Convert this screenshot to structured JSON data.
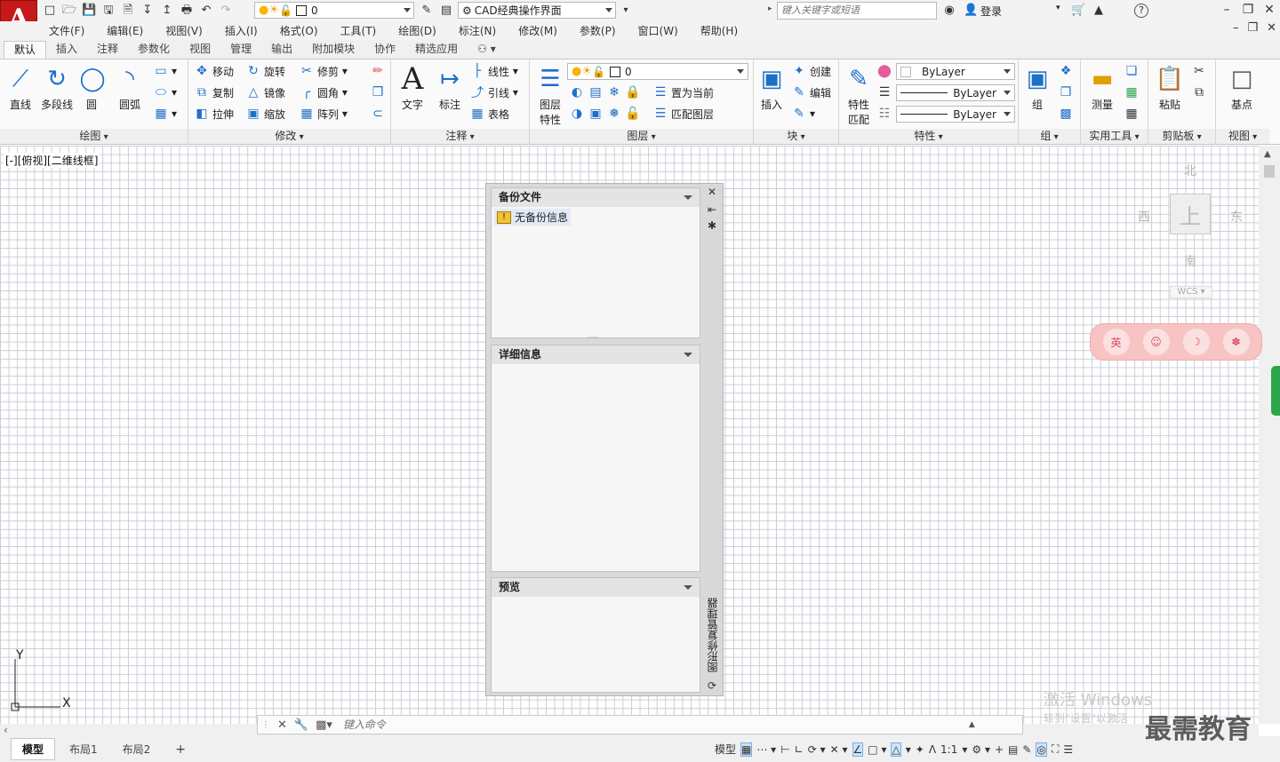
{
  "titlebar": {
    "layer_value": "0",
    "workspace": "CAD经典操作界面",
    "search_placeholder": "键入关键字或短语",
    "login": "登录"
  },
  "menu": [
    "文件(F)",
    "编辑(E)",
    "视图(V)",
    "插入(I)",
    "格式(O)",
    "工具(T)",
    "绘图(D)",
    "标注(N)",
    "修改(M)",
    "参数(P)",
    "窗口(W)",
    "帮助(H)"
  ],
  "ribbon_tabs": [
    "默认",
    "插入",
    "注释",
    "参数化",
    "视图",
    "管理",
    "输出",
    "附加模块",
    "协作",
    "精选应用"
  ],
  "ribbon": {
    "draw": {
      "title": "绘图",
      "line": "直线",
      "polyline": "多段线",
      "circle": "圆",
      "arc": "圆弧"
    },
    "modify": {
      "title": "修改",
      "move": "移动",
      "rotate": "旋转",
      "trim": "修剪",
      "copy": "复制",
      "mirror": "镜像",
      "fillet": "圆角",
      "stretch": "拉伸",
      "scale": "缩放",
      "array": "阵列"
    },
    "annotation": {
      "title": "注释",
      "text": "文字",
      "dimension": "标注",
      "linear": "线性",
      "leader": "引线",
      "table": "表格"
    },
    "layers": {
      "title": "图层",
      "layer_props": "图层\n特性",
      "layer_props_1": "图层",
      "layer_props_2": "特性",
      "layer_value": "0",
      "make_current": "置为当前",
      "match_layer": "匹配图层"
    },
    "block": {
      "title": "块",
      "insert": "插入",
      "create": "创建",
      "edit": "编辑"
    },
    "properties": {
      "title": "特性",
      "match_1": "特性",
      "match_2": "匹配",
      "color": "ByLayer",
      "linetype": "ByLayer",
      "lineweight": "ByLayer"
    },
    "groups": {
      "title": "组",
      "group": "组"
    },
    "utilities": {
      "title": "实用工具",
      "measure": "测量"
    },
    "clipboard": {
      "title": "剪贴板",
      "paste": "粘贴"
    },
    "view": {
      "title": "视图",
      "base": "基点"
    }
  },
  "viewport_label": "[-][俯视][二维线框]",
  "viewcube": {
    "north": "北",
    "south": "南",
    "east": "东",
    "west": "西",
    "face": "上",
    "wcs": "WCS"
  },
  "ime_bar": {
    "lang": "英"
  },
  "palette": {
    "backup_files": "备份文件",
    "no_backup": "无备份信息",
    "details": "详细信息",
    "preview": "预览",
    "title": "图形修复管理器"
  },
  "ucs": {
    "x": "X",
    "y": "Y"
  },
  "command": {
    "placeholder": "键入命令"
  },
  "layout_tabs": [
    "模型",
    "布局1",
    "布局2"
  ],
  "status": {
    "model": "模型",
    "scale": "1:1"
  },
  "watermark": {
    "line1": "激活 Windows",
    "line2": "转到\"设置\"以激活",
    "brand": "最需教育"
  }
}
